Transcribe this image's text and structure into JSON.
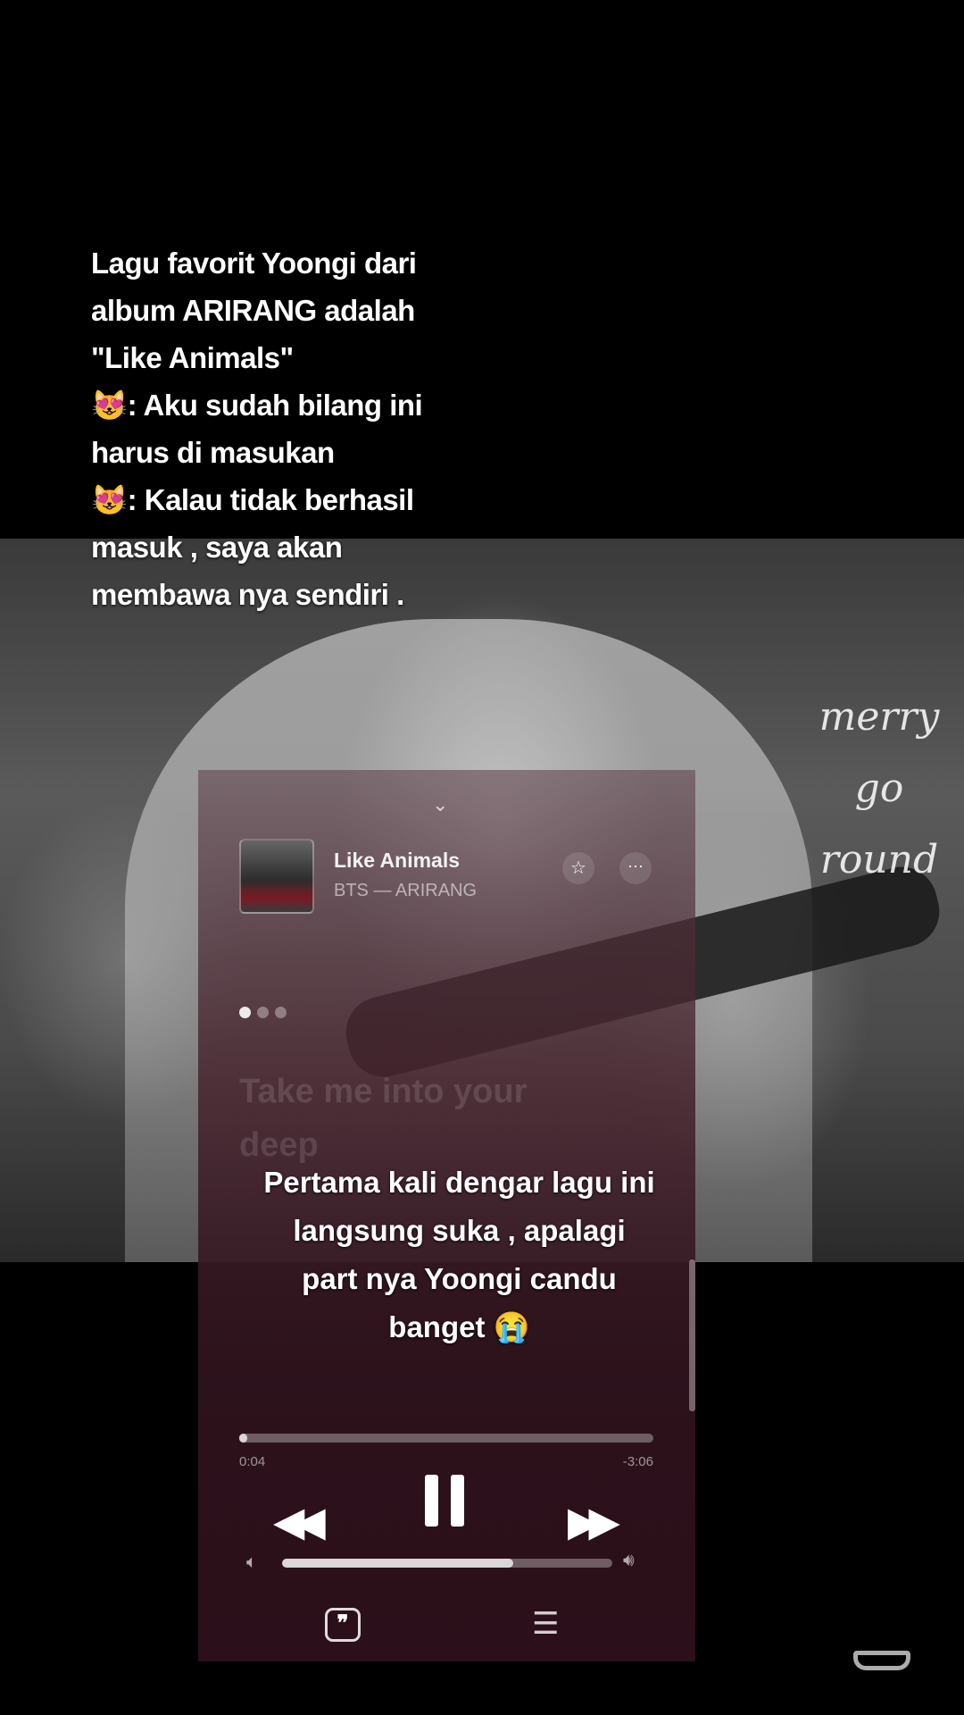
{
  "background": {
    "script_text": [
      "merry",
      "go",
      "round"
    ]
  },
  "caption_top": {
    "lines": [
      "Lagu favorit Yoongi dari",
      "album ARIRANG adalah",
      "\"Like Animals\"",
      "😻: Aku sudah bilang ini",
      "harus di masukan",
      "😻: Kalau tidak berhasil",
      "masuk , saya akan",
      "membawa nya sendiri ."
    ]
  },
  "player": {
    "grabber": "⌄",
    "song_title": "Like Animals",
    "song_subtitle": "BTS — ARIRANG",
    "star_icon": "☆",
    "more_icon": "···",
    "lyrics": [
      "Take me into your",
      "deep"
    ],
    "elapsed": "0:04",
    "remaining": "-3:06",
    "progress_fraction": 0.02,
    "volume_fraction": 0.7,
    "lyrics_icon": "❞",
    "queue_icon": "☰",
    "icons": [
      "chevron-down-icon",
      "star-icon",
      "ellipsis-icon",
      "rewind-icon",
      "pause-icon",
      "fast-forward-icon",
      "volume-low-icon",
      "volume-high-icon",
      "lyrics-icon",
      "queue-icon"
    ]
  },
  "caption_bottom": {
    "lines": [
      "Pertama kali dengar lagu ini",
      "langsung suka , apalagi",
      "part nya Yoongi candu",
      "banget 😭"
    ]
  }
}
